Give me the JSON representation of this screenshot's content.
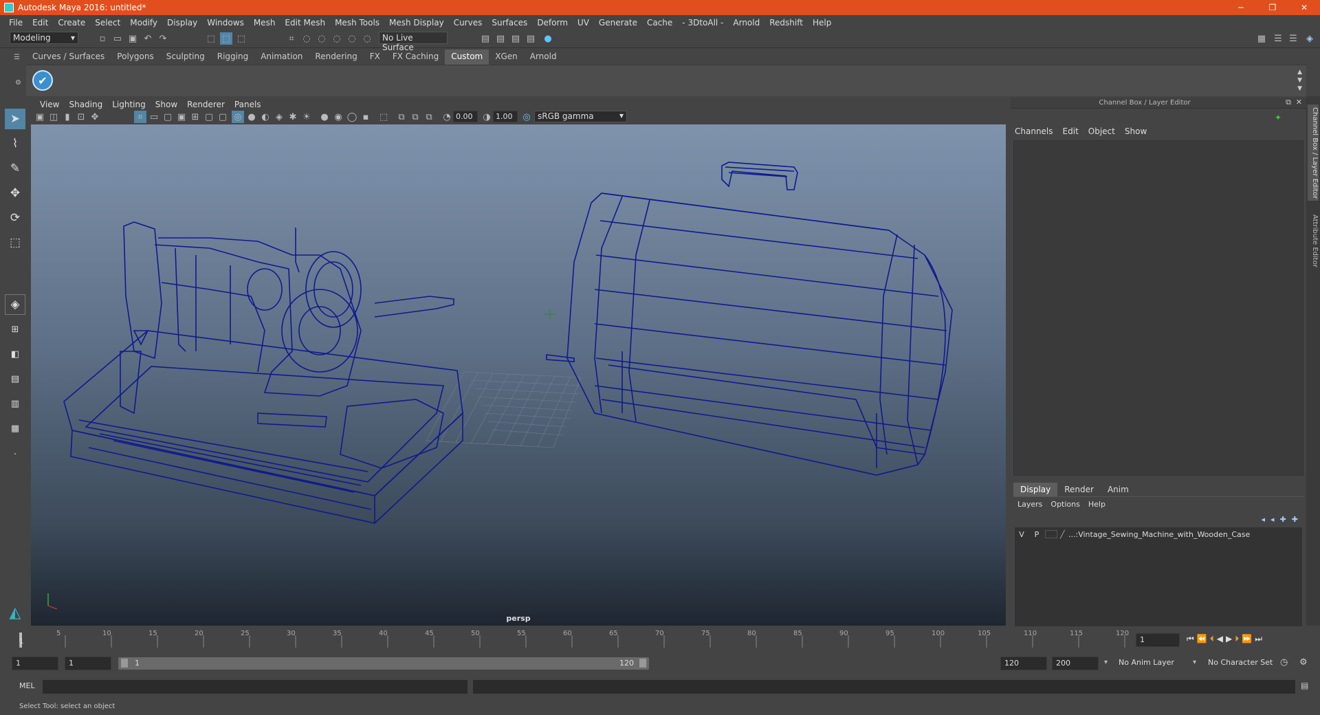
{
  "window": {
    "title": "Autodesk Maya 2016: untitled*",
    "minimize": "─",
    "restore": "❐",
    "close": "✕"
  },
  "menus": [
    "File",
    "Edit",
    "Create",
    "Select",
    "Modify",
    "Display",
    "Windows",
    "Mesh",
    "Edit Mesh",
    "Mesh Tools",
    "Mesh Display",
    "Curves",
    "Surfaces",
    "Deform",
    "UV",
    "Generate",
    "Cache",
    "- 3DtoAll -",
    "Arnold",
    "Redshift",
    "Help"
  ],
  "statusline": {
    "mode": "Modeling",
    "live_surface": "No Live Surface"
  },
  "shelf": {
    "tabs": [
      "Curves / Surfaces",
      "Polygons",
      "Sculpting",
      "Rigging",
      "Animation",
      "Rendering",
      "FX",
      "FX Caching",
      "Custom",
      "XGen",
      "Arnold"
    ],
    "active": "Custom"
  },
  "viewport": {
    "menus": [
      "View",
      "Shading",
      "Lighting",
      "Show",
      "Renderer",
      "Panels"
    ],
    "exposure": "0.00",
    "gamma": "1.00",
    "colorspace": "sRGB gamma",
    "camera": "persp"
  },
  "channelbox": {
    "title": "Channel Box / Layer Editor",
    "menus": [
      "Channels",
      "Edit",
      "Object",
      "Show"
    ]
  },
  "layereditor": {
    "tabs": [
      "Display",
      "Render",
      "Anim"
    ],
    "active": "Display",
    "menus": [
      "Layers",
      "Options",
      "Help"
    ],
    "layer": {
      "v": "V",
      "p": "P",
      "name": "...:Vintage_Sewing_Machine_with_Wooden_Case"
    }
  },
  "sidetabs": {
    "channel": "Channel Box / Layer Editor",
    "attribute": "Attribute Editor"
  },
  "timeline": {
    "ticks": [
      "5",
      "10",
      "15",
      "20",
      "25",
      "30",
      "35",
      "40",
      "45",
      "50",
      "55",
      "60",
      "65",
      "70",
      "75",
      "80",
      "85",
      "90",
      "95",
      "100",
      "105",
      "110",
      "115",
      "120"
    ],
    "start_mark": "1",
    "current_frame": "1"
  },
  "range": {
    "start": "1",
    "playback_start": "1",
    "slider_start": "1",
    "slider_end": "120",
    "playback_end": "120",
    "end": "200",
    "anim_layer": "No Anim Layer",
    "char_set": "No Character Set"
  },
  "cmd": {
    "lang": "MEL"
  },
  "help": {
    "text": "Select Tool: select an object"
  }
}
